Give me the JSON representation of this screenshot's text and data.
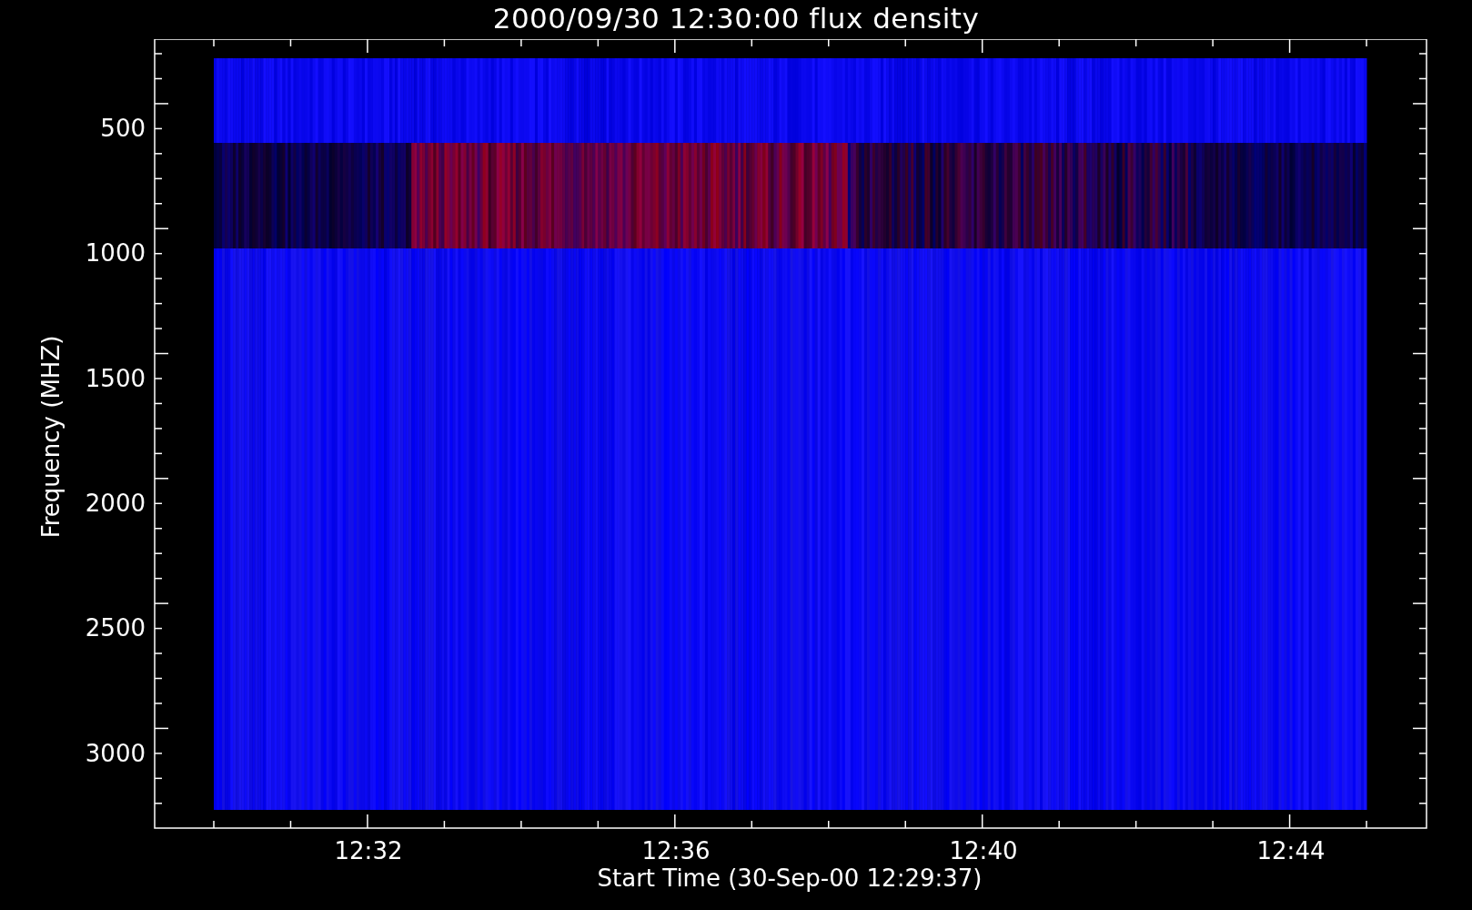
{
  "title": "2000/09/30 12:30:00 flux density",
  "y_axis": {
    "label": "Frequency (MHZ)",
    "ticks": [
      "500",
      "1000",
      "1500",
      "2000",
      "2500",
      "3000"
    ]
  },
  "x_axis": {
    "label": "Start Time (30-Sep-00 12:29:37)",
    "ticks": [
      "12:32",
      "12:36",
      "12:40",
      "12:44"
    ]
  }
}
